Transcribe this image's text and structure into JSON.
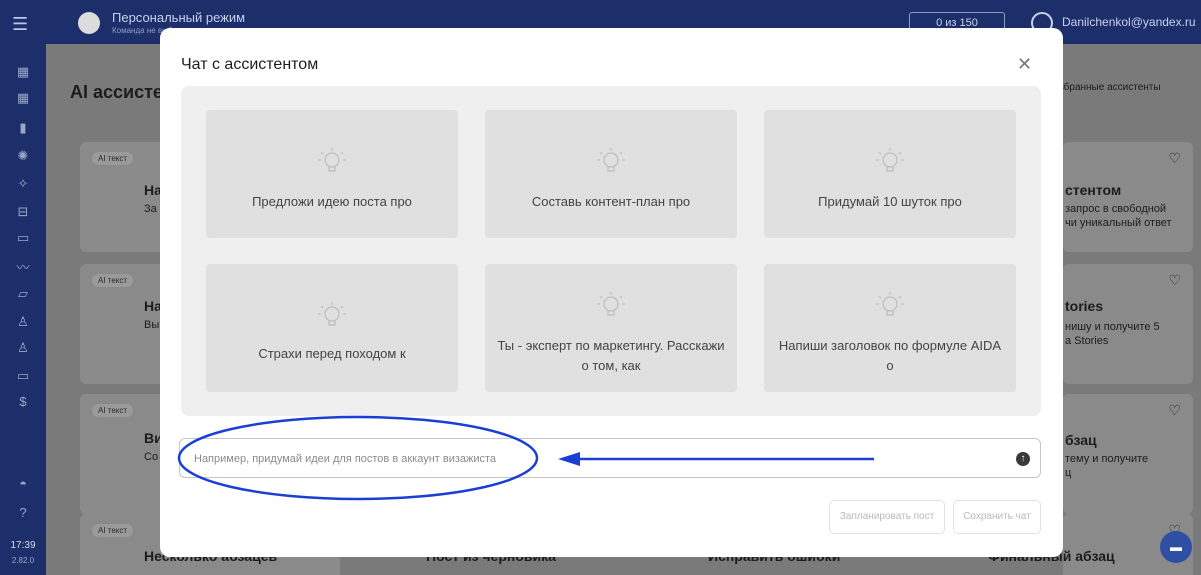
{
  "topbar": {
    "mode": "Персональный режим",
    "sub": "Команда не выбрана",
    "quota": "0 из 150",
    "email": "Danilchenkol@yandex.ru"
  },
  "rail": {
    "time": "17:39",
    "version": "2.82.0"
  },
  "background": {
    "page_title": "AI ассистенты",
    "favorites": "Избранные ассистенты",
    "tag": "AI текст",
    "right_cards": [
      {
        "title": "стентом",
        "text": "запрос в свободной\nчи уникальный ответ"
      },
      {
        "title": "tories",
        "text": "нишу и получите 5\nа Stories"
      },
      {
        "title": "бзац",
        "text": "тему и получите\nц"
      }
    ],
    "left_cards": [
      {
        "title": "На",
        "text": "За\nсл"
      },
      {
        "title": "На",
        "text": "Вы\nни"
      },
      {
        "title": "Ви",
        "text": "Со\nчт"
      }
    ],
    "bottom_titles": [
      "Несколько абзацев",
      "Пост из черновика",
      "Исправить ошибки",
      "Финальный абзац"
    ]
  },
  "modal": {
    "title": "Чат с ассистентом",
    "close_icon": "close-icon",
    "suggestions": [
      "Предложи идею поста про",
      "Составь контент-план про",
      "Придумай 10 шуток про",
      "Страхи перед походом к",
      "Ты - эксперт по маркетингу. Расскажи о том, как",
      "Напиши заголовок по формуле AIDA о"
    ],
    "input": {
      "placeholder": "Например, придумай идеи для постов в аккаунт визажиста",
      "value": ""
    },
    "buttons": {
      "schedule": "Запланировать пост",
      "save": "Сохранить чат"
    }
  },
  "colors": {
    "rail": "#1d2f6b",
    "annotation": "#1a3fd6",
    "chat_bubble": "#2f4fa5"
  }
}
